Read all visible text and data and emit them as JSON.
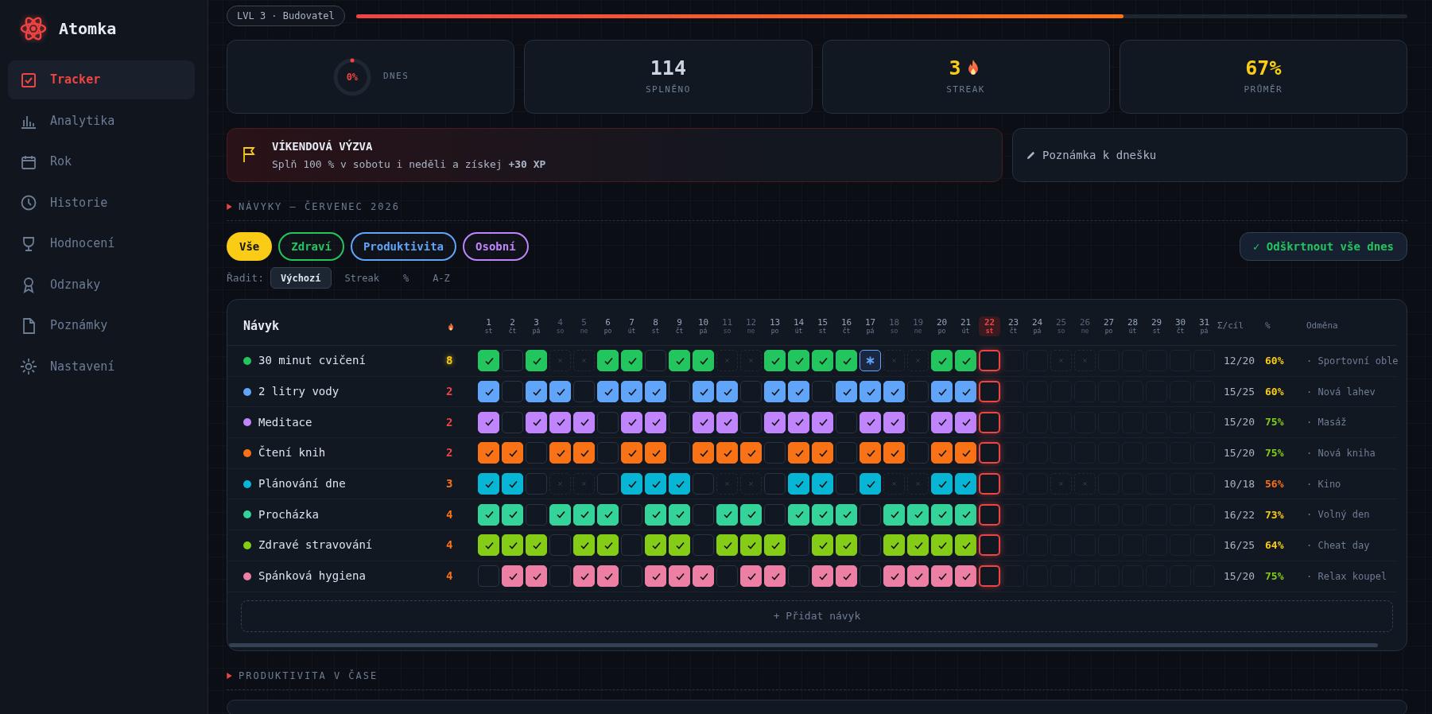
{
  "app": {
    "name": "Atomka"
  },
  "sidebar": {
    "items": [
      {
        "label": "Tracker",
        "selected": true
      },
      {
        "label": "Analytika",
        "selected": false
      },
      {
        "label": "Rok",
        "selected": false
      },
      {
        "label": "Historie",
        "selected": false
      },
      {
        "label": "Hodnocení",
        "selected": false
      },
      {
        "label": "Odznaky",
        "selected": false
      },
      {
        "label": "Poznámky",
        "selected": false
      },
      {
        "label": "Nastavení",
        "selected": false
      }
    ]
  },
  "level_badge": "LVL 3 · Budovatel",
  "xp_bar": {
    "level": 0.73
  },
  "stats": [
    {
      "kind": "ring",
      "value": "0%",
      "label": "DNES",
      "level": 0
    },
    {
      "kind": "number",
      "value": "114",
      "label": "SPLNĚNO",
      "highlight": false,
      "flame": false
    },
    {
      "kind": "number",
      "value": "3",
      "label": "STREAK",
      "highlight": true,
      "flame": true
    },
    {
      "kind": "number",
      "value": "67%",
      "label": "PRŮMĚR",
      "highlight": true,
      "flame": false
    }
  ],
  "challenge": {
    "title": "VÍKENDOVÁ VÝZVA",
    "text": "Splň 100 % v sobotu i neděli a získej **+30 XP**"
  },
  "note_button": "Poznámka k dnešku",
  "habits_section": {
    "title": "NÁVYKY — ČERVENEC 2026"
  },
  "filters": [
    {
      "label": "Vše",
      "selected": true,
      "color": "#facc15"
    },
    {
      "label": "Zdraví",
      "selected": false,
      "color": "#22c55e"
    },
    {
      "label": "Produktivita",
      "selected": false,
      "color": "#60a5fa"
    },
    {
      "label": "Osobní",
      "selected": false,
      "color": "#c084fc"
    }
  ],
  "check_all_button": "✓ Odškrtnout vše dnes",
  "sort": {
    "label": "Řadit:",
    "options": [
      {
        "label": "Výchozí",
        "selected": true
      },
      {
        "label": "Streak",
        "selected": false
      },
      {
        "label": "%",
        "selected": false
      },
      {
        "label": "A-Z",
        "selected": false
      }
    ]
  },
  "table": {
    "columns": {
      "name": "Návyk",
      "sum": "Σ/cíl",
      "percent": "%",
      "reward": "Odměna"
    },
    "days": [
      {
        "day": "1",
        "weekday": "st",
        "weekend": false,
        "today": false
      },
      {
        "day": "2",
        "weekday": "čt",
        "weekend": false,
        "today": false
      },
      {
        "day": "3",
        "weekday": "pá",
        "weekend": false,
        "today": false
      },
      {
        "day": "4",
        "weekday": "so",
        "weekend": true,
        "today": false
      },
      {
        "day": "5",
        "weekday": "ne",
        "weekend": true,
        "today": false
      },
      {
        "day": "6",
        "weekday": "po",
        "weekend": false,
        "today": false
      },
      {
        "day": "7",
        "weekday": "út",
        "weekend": false,
        "today": false
      },
      {
        "day": "8",
        "weekday": "st",
        "weekend": false,
        "today": false
      },
      {
        "day": "9",
        "weekday": "čt",
        "weekend": false,
        "today": false
      },
      {
        "day": "10",
        "weekday": "pá",
        "weekend": false,
        "today": false
      },
      {
        "day": "11",
        "weekday": "so",
        "weekend": true,
        "today": false
      },
      {
        "day": "12",
        "weekday": "ne",
        "weekend": true,
        "today": false
      },
      {
        "day": "13",
        "weekday": "po",
        "weekend": false,
        "today": false
      },
      {
        "day": "14",
        "weekday": "út",
        "weekend": false,
        "today": false
      },
      {
        "day": "15",
        "weekday": "st",
        "weekend": false,
        "today": false
      },
      {
        "day": "16",
        "weekday": "čt",
        "weekend": false,
        "today": false
      },
      {
        "day": "17",
        "weekday": "pá",
        "weekend": false,
        "today": false
      },
      {
        "day": "18",
        "weekday": "so",
        "weekend": true,
        "today": false
      },
      {
        "day": "19",
        "weekday": "ne",
        "weekend": true,
        "today": false
      },
      {
        "day": "20",
        "weekday": "po",
        "weekend": false,
        "today": false
      },
      {
        "day": "21",
        "weekday": "út",
        "weekend": false,
        "today": false
      },
      {
        "day": "22",
        "weekday": "st",
        "weekend": false,
        "today": true
      },
      {
        "day": "23",
        "weekday": "čt",
        "weekend": false,
        "today": false
      },
      {
        "day": "24",
        "weekday": "pá",
        "weekend": false,
        "today": false
      },
      {
        "day": "25",
        "weekday": "so",
        "weekend": true,
        "today": false
      },
      {
        "day": "26",
        "weekday": "ne",
        "weekend": true,
        "today": false
      },
      {
        "day": "27",
        "weekday": "po",
        "weekend": false,
        "today": false
      },
      {
        "day": "28",
        "weekday": "út",
        "weekend": false,
        "today": false
      },
      {
        "day": "29",
        "weekday": "st",
        "weekend": false,
        "today": false
      },
      {
        "day": "30",
        "weekday": "čt",
        "weekend": false,
        "today": false
      },
      {
        "day": "31",
        "weekday": "pá",
        "weekend": false,
        "today": false
      }
    ],
    "habits": [
      {
        "name": "30 minut cvičení",
        "color": "#22c55e",
        "streak": "8",
        "sum": "12/20",
        "percent": "60%",
        "reward": "· Sportovní oble",
        "days": [
          {
            "kind": "done"
          },
          {
            "kind": "missed"
          },
          {
            "kind": "done"
          },
          {
            "kind": "skip"
          },
          {
            "kind": "skip"
          },
          {
            "kind": "done"
          },
          {
            "kind": "done"
          },
          {
            "kind": "missed"
          },
          {
            "kind": "done"
          },
          {
            "kind": "done"
          },
          {
            "kind": "skip"
          },
          {
            "kind": "skip"
          },
          {
            "kind": "done"
          },
          {
            "kind": "done"
          },
          {
            "kind": "done"
          },
          {
            "kind": "done"
          },
          {
            "kind": "freeze"
          },
          {
            "kind": "skip"
          },
          {
            "kind": "skip"
          },
          {
            "kind": "done"
          },
          {
            "kind": "done"
          },
          {
            "kind": "today"
          },
          {
            "kind": "future"
          },
          {
            "kind": "future"
          },
          {
            "kind": "skip"
          },
          {
            "kind": "skip"
          },
          {
            "kind": "future"
          },
          {
            "kind": "future"
          },
          {
            "kind": "future"
          },
          {
            "kind": "future"
          },
          {
            "kind": "future"
          }
        ]
      },
      {
        "name": "2 litry vody",
        "color": "#60a5fa",
        "streak": "2",
        "sum": "15/25",
        "percent": "60%",
        "reward": "· Nová lahev",
        "days": [
          {
            "kind": "done"
          },
          {
            "kind": "missed"
          },
          {
            "kind": "done"
          },
          {
            "kind": "done"
          },
          {
            "kind": "missed"
          },
          {
            "kind": "done"
          },
          {
            "kind": "done"
          },
          {
            "kind": "done"
          },
          {
            "kind": "missed"
          },
          {
            "kind": "done"
          },
          {
            "kind": "done"
          },
          {
            "kind": "missed"
          },
          {
            "kind": "done"
          },
          {
            "kind": "done"
          },
          {
            "kind": "missed"
          },
          {
            "kind": "done"
          },
          {
            "kind": "done"
          },
          {
            "kind": "done"
          },
          {
            "kind": "missed"
          },
          {
            "kind": "done"
          },
          {
            "kind": "done"
          },
          {
            "kind": "today"
          },
          {
            "kind": "future"
          },
          {
            "kind": "future"
          },
          {
            "kind": "future"
          },
          {
            "kind": "future"
          },
          {
            "kind": "future"
          },
          {
            "kind": "future"
          },
          {
            "kind": "future"
          },
          {
            "kind": "future"
          },
          {
            "kind": "future"
          }
        ]
      },
      {
        "name": "Meditace",
        "color": "#c084fc",
        "streak": "2",
        "sum": "15/20",
        "percent": "75%",
        "reward": "· Masáž",
        "days": [
          {
            "kind": "done"
          },
          {
            "kind": "missed"
          },
          {
            "kind": "done"
          },
          {
            "kind": "done"
          },
          {
            "kind": "done"
          },
          {
            "kind": "missed"
          },
          {
            "kind": "done"
          },
          {
            "kind": "done"
          },
          {
            "kind": "missed"
          },
          {
            "kind": "done"
          },
          {
            "kind": "done"
          },
          {
            "kind": "missed"
          },
          {
            "kind": "done"
          },
          {
            "kind": "done"
          },
          {
            "kind": "done"
          },
          {
            "kind": "missed"
          },
          {
            "kind": "done"
          },
          {
            "kind": "done"
          },
          {
            "kind": "missed"
          },
          {
            "kind": "done"
          },
          {
            "kind": "done"
          },
          {
            "kind": "today"
          },
          {
            "kind": "future"
          },
          {
            "kind": "future"
          },
          {
            "kind": "future"
          },
          {
            "kind": "future"
          },
          {
            "kind": "future"
          },
          {
            "kind": "future"
          },
          {
            "kind": "future"
          },
          {
            "kind": "future"
          },
          {
            "kind": "future"
          }
        ]
      },
      {
        "name": "Čtení knih",
        "color": "#f97316",
        "streak": "2",
        "sum": "15/20",
        "percent": "75%",
        "reward": "· Nová kniha",
        "days": [
          {
            "kind": "done"
          },
          {
            "kind": "done"
          },
          {
            "kind": "missed"
          },
          {
            "kind": "done"
          },
          {
            "kind": "done"
          },
          {
            "kind": "missed"
          },
          {
            "kind": "done"
          },
          {
            "kind": "done"
          },
          {
            "kind": "missed"
          },
          {
            "kind": "done"
          },
          {
            "kind": "done"
          },
          {
            "kind": "done"
          },
          {
            "kind": "missed"
          },
          {
            "kind": "done"
          },
          {
            "kind": "done"
          },
          {
            "kind": "missed"
          },
          {
            "kind": "done"
          },
          {
            "kind": "done"
          },
          {
            "kind": "missed"
          },
          {
            "kind": "done"
          },
          {
            "kind": "done"
          },
          {
            "kind": "today"
          },
          {
            "kind": "future"
          },
          {
            "kind": "future"
          },
          {
            "kind": "future"
          },
          {
            "kind": "future"
          },
          {
            "kind": "future"
          },
          {
            "kind": "future"
          },
          {
            "kind": "future"
          },
          {
            "kind": "future"
          },
          {
            "kind": "future"
          }
        ]
      },
      {
        "name": "Plánování dne",
        "color": "#06b6d4",
        "streak": "3",
        "sum": "10/18",
        "percent": "56%",
        "reward": "· Kino",
        "days": [
          {
            "kind": "done"
          },
          {
            "kind": "done"
          },
          {
            "kind": "missed"
          },
          {
            "kind": "skip"
          },
          {
            "kind": "skip"
          },
          {
            "kind": "missed"
          },
          {
            "kind": "done"
          },
          {
            "kind": "done"
          },
          {
            "kind": "done"
          },
          {
            "kind": "missed"
          },
          {
            "kind": "skip"
          },
          {
            "kind": "skip"
          },
          {
            "kind": "missed"
          },
          {
            "kind": "done"
          },
          {
            "kind": "done"
          },
          {
            "kind": "missed"
          },
          {
            "kind": "done"
          },
          {
            "kind": "skip"
          },
          {
            "kind": "skip"
          },
          {
            "kind": "done"
          },
          {
            "kind": "done"
          },
          {
            "kind": "today"
          },
          {
            "kind": "future"
          },
          {
            "kind": "future"
          },
          {
            "kind": "skip"
          },
          {
            "kind": "skip"
          },
          {
            "kind": "future"
          },
          {
            "kind": "future"
          },
          {
            "kind": "future"
          },
          {
            "kind": "future"
          },
          {
            "kind": "future"
          }
        ]
      },
      {
        "name": "Procházka",
        "color": "#34d399",
        "streak": "4",
        "sum": "16/22",
        "percent": "73%",
        "reward": "· Volný den",
        "days": [
          {
            "kind": "done"
          },
          {
            "kind": "done"
          },
          {
            "kind": "missed"
          },
          {
            "kind": "done"
          },
          {
            "kind": "done"
          },
          {
            "kind": "done"
          },
          {
            "kind": "missed"
          },
          {
            "kind": "done"
          },
          {
            "kind": "done"
          },
          {
            "kind": "missed"
          },
          {
            "kind": "done"
          },
          {
            "kind": "done"
          },
          {
            "kind": "missed"
          },
          {
            "kind": "done"
          },
          {
            "kind": "done"
          },
          {
            "kind": "done"
          },
          {
            "kind": "missed"
          },
          {
            "kind": "done"
          },
          {
            "kind": "done"
          },
          {
            "kind": "done"
          },
          {
            "kind": "done"
          },
          {
            "kind": "today"
          },
          {
            "kind": "future"
          },
          {
            "kind": "future"
          },
          {
            "kind": "future"
          },
          {
            "kind": "future"
          },
          {
            "kind": "future"
          },
          {
            "kind": "future"
          },
          {
            "kind": "future"
          },
          {
            "kind": "future"
          },
          {
            "kind": "future"
          }
        ]
      },
      {
        "name": "Zdravé stravování",
        "color": "#84cc16",
        "streak": "4",
        "sum": "16/25",
        "percent": "64%",
        "reward": "· Cheat day",
        "days": [
          {
            "kind": "done"
          },
          {
            "kind": "done"
          },
          {
            "kind": "done"
          },
          {
            "kind": "missed"
          },
          {
            "kind": "done"
          },
          {
            "kind": "done"
          },
          {
            "kind": "missed"
          },
          {
            "kind": "done"
          },
          {
            "kind": "done"
          },
          {
            "kind": "missed"
          },
          {
            "kind": "done"
          },
          {
            "kind": "done"
          },
          {
            "kind": "done"
          },
          {
            "kind": "missed"
          },
          {
            "kind": "done"
          },
          {
            "kind": "done"
          },
          {
            "kind": "missed"
          },
          {
            "kind": "done"
          },
          {
            "kind": "done"
          },
          {
            "kind": "done"
          },
          {
            "kind": "done"
          },
          {
            "kind": "today"
          },
          {
            "kind": "future"
          },
          {
            "kind": "future"
          },
          {
            "kind": "future"
          },
          {
            "kind": "future"
          },
          {
            "kind": "future"
          },
          {
            "kind": "future"
          },
          {
            "kind": "future"
          },
          {
            "kind": "future"
          },
          {
            "kind": "future"
          }
        ]
      },
      {
        "name": "Spánková hygiena",
        "color": "#ec7fa3",
        "streak": "4",
        "sum": "15/20",
        "percent": "75%",
        "reward": "· Relax koupel",
        "days": [
          {
            "kind": "missed"
          },
          {
            "kind": "done"
          },
          {
            "kind": "done"
          },
          {
            "kind": "missed"
          },
          {
            "kind": "done"
          },
          {
            "kind": "done"
          },
          {
            "kind": "missed"
          },
          {
            "kind": "done"
          },
          {
            "kind": "done"
          },
          {
            "kind": "done"
          },
          {
            "kind": "missed"
          },
          {
            "kind": "done"
          },
          {
            "kind": "done"
          },
          {
            "kind": "missed"
          },
          {
            "kind": "done"
          },
          {
            "kind": "done"
          },
          {
            "kind": "missed"
          },
          {
            "kind": "done"
          },
          {
            "kind": "done"
          },
          {
            "kind": "done"
          },
          {
            "kind": "done"
          },
          {
            "kind": "today"
          },
          {
            "kind": "future"
          },
          {
            "kind": "future"
          },
          {
            "kind": "future"
          },
          {
            "kind": "future"
          },
          {
            "kind": "future"
          },
          {
            "kind": "future"
          },
          {
            "kind": "future"
          },
          {
            "kind": "future"
          },
          {
            "kind": "future"
          }
        ]
      }
    ]
  },
  "add_habit_button": "+ Přidat návyk",
  "productivity_section": {
    "title": "PRODUKTIVITA V ČASE"
  }
}
